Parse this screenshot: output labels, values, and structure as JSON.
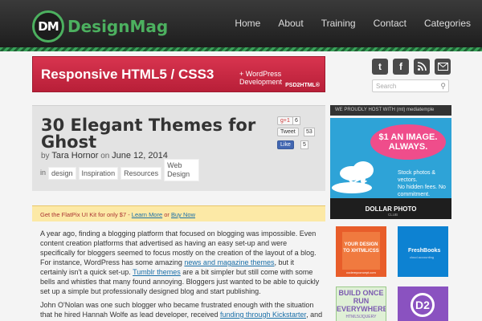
{
  "site": {
    "logo_badge": "DM",
    "logo_text": "DesignMag"
  },
  "nav": [
    "Home",
    "About",
    "Training",
    "Contact",
    "Categories"
  ],
  "banner": {
    "title": "Responsive HTML5 / CSS3",
    "subtitle": "+ WordPress Development",
    "brand": "PSD2HTML®"
  },
  "social": {
    "twitter": "t",
    "facebook": "f",
    "rss": "r",
    "email": "@"
  },
  "search": {
    "placeholder": "Search"
  },
  "post": {
    "title": "30 Elegant Themes for Ghost",
    "by": "by",
    "author": "Tara Hornor",
    "on": "on",
    "date": "June 12, 2014",
    "in": "in",
    "tags": [
      "design",
      "Inspiration",
      "Resources",
      "Web Design"
    ]
  },
  "share": {
    "gplus": "g+1",
    "gplus_count": "6",
    "tweet": "Tweet",
    "tweet_count": "53",
    "like": "Like",
    "like_count": "5"
  },
  "promo": {
    "text": "Get the FlatPix UI Kit for only $7 - ",
    "learn_more": "Learn More",
    "or": " or ",
    "buy_now": "Buy Now"
  },
  "content": {
    "p1_a": "A year ago, finding a blogging platform that focused on blogging was impossible. Even content creation platforms that advertised as having an easy set-up and were specifically for bloggers seemed to focus mostly on the creation of the layout of a blog. For instance, WordPress has some amazing ",
    "p1_link1": "news and magazine themes",
    "p1_b": ", but it certainly isn't a quick set-up. ",
    "p1_link2": "Tumblr themes",
    "p1_c": " are a bit simpler but still come with some bells and whistles that many found annoying. Bloggers just wanted to be able to quickly set up a simple but professionally designed blog and start publishing.",
    "p2_a": "John O'Nolan was one such blogger who became frustrated enough with the situation that he hired Hannah Wolfe as lead developer, received ",
    "p2_link": "funding through Kickstarter",
    "p2_b": ", and created a"
  },
  "sidebar": {
    "hosting": "WE PROUDLY HOST WITH (mt) mediatemple",
    "ad_price": "$1 AN IMAGE.",
    "ad_always": "ALWAYS.",
    "ad_copy": [
      "Stock photos & vectors.",
      "No hidden fees. No commitment."
    ],
    "ad_brand": "DOLLAR PHOTO",
    "ad_brand_sub": "CLUB",
    "ad2": "YOUR DESIGN TO XHTML/CSS",
    "ad2_sub": "codemyconcept.com",
    "ad3": "FreshBooks",
    "ad3_sub": "cloud accounting",
    "ad4": "BUILD ONCE RUN EVERYWHERE",
    "ad4_sub": "HTML5/JQUERY",
    "ad5": "D2"
  }
}
